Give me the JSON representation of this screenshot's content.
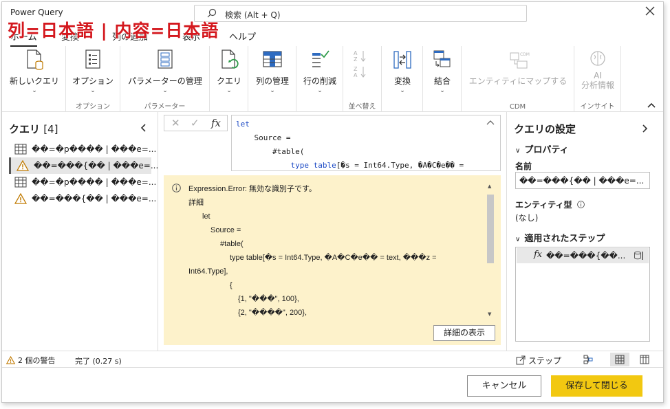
{
  "window": {
    "title": "Power Query",
    "search_placeholder": "検索 (Alt + Q)"
  },
  "overlay_title": "列=日本語 | 内容=日本語",
  "tabs": [
    {
      "label": "ホーム",
      "active": true
    },
    {
      "label": "変換"
    },
    {
      "label": "列の追加"
    },
    {
      "label": "表示"
    },
    {
      "label": "ヘルプ"
    }
  ],
  "ribbon": {
    "new_query": "新しいクエリ",
    "options": "オプション",
    "options_group": "オプション",
    "manage_params": "パラメーターの管理",
    "params_group": "パラメーター",
    "query": "クエリ",
    "manage_columns": "列の管理",
    "reduce_rows": "行の削減",
    "sort_group": "並べ替え",
    "transform": "変換",
    "combine": "結合",
    "map_entity": "エンティティにマップする",
    "cdm_group": "CDM",
    "ai_line1": "AI",
    "ai_line2": "分析情報",
    "insight_group": "インサイト"
  },
  "queries_panel": {
    "title": "クエリ",
    "count": "[4]",
    "items": [
      {
        "name": "��=�p���� | ���e=...",
        "icon": "table-icon",
        "selected": false
      },
      {
        "name": "��=���{�� | ���e=...",
        "icon": "warning-icon",
        "selected": true
      },
      {
        "name": "��=�p���� | ���e=...",
        "icon": "table-icon",
        "selected": false
      },
      {
        "name": "��=���{�� | ���e=...",
        "icon": "warning-icon",
        "selected": false
      }
    ]
  },
  "formula": {
    "line1": "let",
    "line2": "    Source =",
    "line3": "        #table(",
    "line4_kw": "type table",
    "line4_rest": "[�s = Int64.Type, �A�C�e�� ="
  },
  "error": {
    "l1": "Expression.Error: 無効な識別子です。",
    "l2": "詳細",
    "l3": "let",
    "l4": "Source =",
    "l5": "#table(",
    "l6": "type table[�s = Int64.Type, �A�C�e�� = text, ���z =",
    "l7": "Int64.Type],",
    "l8": "{",
    "l9": "{1, \"���\", 100},",
    "l10": "{2, \"����\", 200},",
    "detail_button": "詳細の表示"
  },
  "settings_panel": {
    "title": "クエリの設定",
    "properties": "プロパティ",
    "name_label": "名前",
    "name_value": "��=���{�� | ���e=...",
    "entity_label": "エンティティ型",
    "entity_value": "(なし)",
    "applied_steps": "適用されたステップ",
    "step_name": "��=���{��...",
    "step_fx": "fx"
  },
  "status": {
    "warnings": "2 個の警告",
    "done": "完了 (0.27 s)",
    "steps": "ステップ"
  },
  "footer": {
    "cancel": "キャンセル",
    "save": "保存して閉じる"
  },
  "colors": {
    "save_button": "#f2c811",
    "error_bg": "#fdf2cb",
    "overlay_title": "#d4181e",
    "table_icon_blue": "#2e6bc0"
  }
}
